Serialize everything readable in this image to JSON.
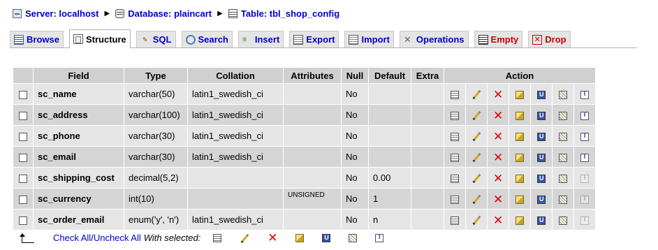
{
  "breadcrumb": {
    "server": "Server: localhost",
    "database": "Database: plaincart",
    "table": "Table: tbl_shop_config"
  },
  "tabs": [
    {
      "key": "browse",
      "label": "Browse",
      "icon": "browse-icon"
    },
    {
      "key": "structure",
      "label": "Structure",
      "icon": "structure-icon",
      "active": true
    },
    {
      "key": "sql",
      "label": "SQL",
      "icon": "sql-icon"
    },
    {
      "key": "search",
      "label": "Search",
      "icon": "search-icon"
    },
    {
      "key": "insert",
      "label": "Insert",
      "icon": "insert-icon"
    },
    {
      "key": "export",
      "label": "Export",
      "icon": "export-icon"
    },
    {
      "key": "import",
      "label": "Import",
      "icon": "import-icon"
    },
    {
      "key": "operations",
      "label": "Operations",
      "icon": "operations-icon"
    },
    {
      "key": "empty",
      "label": "Empty",
      "icon": "empty-icon"
    },
    {
      "key": "drop",
      "label": "Drop",
      "icon": "drop-icon"
    }
  ],
  "table": {
    "headers": {
      "field": "Field",
      "type": "Type",
      "collation": "Collation",
      "attributes": "Attributes",
      "null": "Null",
      "default": "Default",
      "extra": "Extra",
      "action": "Action"
    },
    "rows": [
      {
        "field": "sc_name",
        "type": "varchar(50)",
        "collation": "latin1_swedish_ci",
        "attributes": "",
        "null": "No",
        "default": "",
        "extra": "",
        "fulltext_enabled": true
      },
      {
        "field": "sc_address",
        "type": "varchar(100)",
        "collation": "latin1_swedish_ci",
        "attributes": "",
        "null": "No",
        "default": "",
        "extra": "",
        "fulltext_enabled": true
      },
      {
        "field": "sc_phone",
        "type": "varchar(30)",
        "collation": "latin1_swedish_ci",
        "attributes": "",
        "null": "No",
        "default": "",
        "extra": "",
        "fulltext_enabled": true
      },
      {
        "field": "sc_email",
        "type": "varchar(30)",
        "collation": "latin1_swedish_ci",
        "attributes": "",
        "null": "No",
        "default": "",
        "extra": "",
        "fulltext_enabled": true
      },
      {
        "field": "sc_shipping_cost",
        "type": "decimal(5,2)",
        "collation": "",
        "attributes": "",
        "null": "No",
        "default": "0.00",
        "extra": "",
        "fulltext_enabled": false
      },
      {
        "field": "sc_currency",
        "type": "int(10)",
        "collation": "",
        "attributes": "UNSIGNED",
        "null": "No",
        "default": "1",
        "extra": "",
        "fulltext_enabled": false
      },
      {
        "field": "sc_order_email",
        "type": "enum('y', 'n')",
        "collation": "latin1_swedish_ci",
        "attributes": "",
        "null": "No",
        "default": "n",
        "extra": "",
        "fulltext_enabled": false
      }
    ]
  },
  "footer": {
    "check_all": "Check All",
    "separator": " / ",
    "uncheck_all": "Uncheck All",
    "with_selected": "With selected:"
  },
  "colors": {
    "link": "#0000cc",
    "drop": "#cc0000",
    "row_odd": "#e5e5e5",
    "row_even": "#d5d5d5",
    "header": "#d0d0d0"
  }
}
